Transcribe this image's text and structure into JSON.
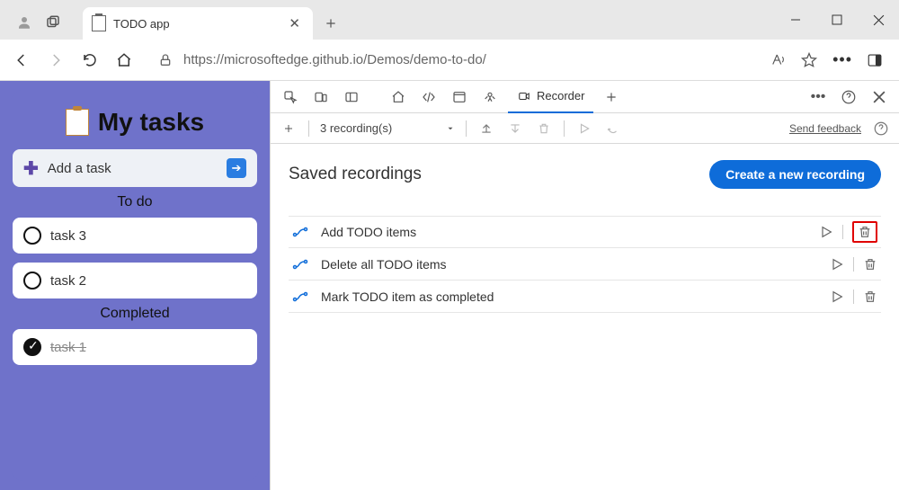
{
  "browser": {
    "tab_title": "TODO app",
    "url": "https://microsoftedge.github.io/Demos/demo-to-do/"
  },
  "app": {
    "title": "My tasks",
    "add_task_label": "Add a task",
    "section_todo": "To do",
    "section_completed": "Completed",
    "tasks_todo": [
      {
        "label": "task 3"
      },
      {
        "label": "task 2"
      }
    ],
    "tasks_done": [
      {
        "label": "task 1"
      }
    ]
  },
  "devtools": {
    "active_tab": "Recorder",
    "toolbar_count": "3 recording(s)",
    "feedback_label": "Send feedback",
    "heading": "Saved recordings",
    "create_button": "Create a new recording",
    "recordings": [
      {
        "name": "Add TODO items",
        "highlight_delete": true
      },
      {
        "name": "Delete all TODO items",
        "highlight_delete": false
      },
      {
        "name": "Mark TODO item as completed",
        "highlight_delete": false
      }
    ]
  }
}
